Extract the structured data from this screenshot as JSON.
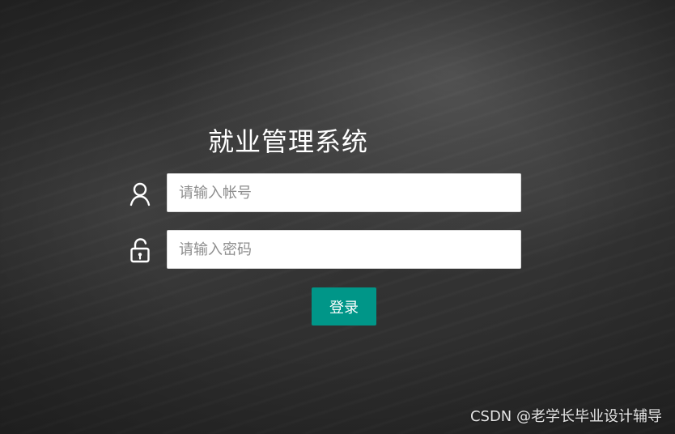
{
  "app": {
    "title": "就业管理系统"
  },
  "login": {
    "username": {
      "icon": "user-icon",
      "placeholder": "请输入帐号",
      "value": ""
    },
    "password": {
      "icon": "unlock-icon",
      "placeholder": "请输入密码",
      "value": ""
    },
    "submit_label": "登录"
  },
  "footer": {
    "watermark": "CSDN @老学长毕业设计辅导"
  },
  "colors": {
    "primary": "#009688",
    "title": "#ffffff",
    "input_bg": "#ffffff",
    "placeholder": "#8e8e8e",
    "background": "#2f2f2f"
  }
}
